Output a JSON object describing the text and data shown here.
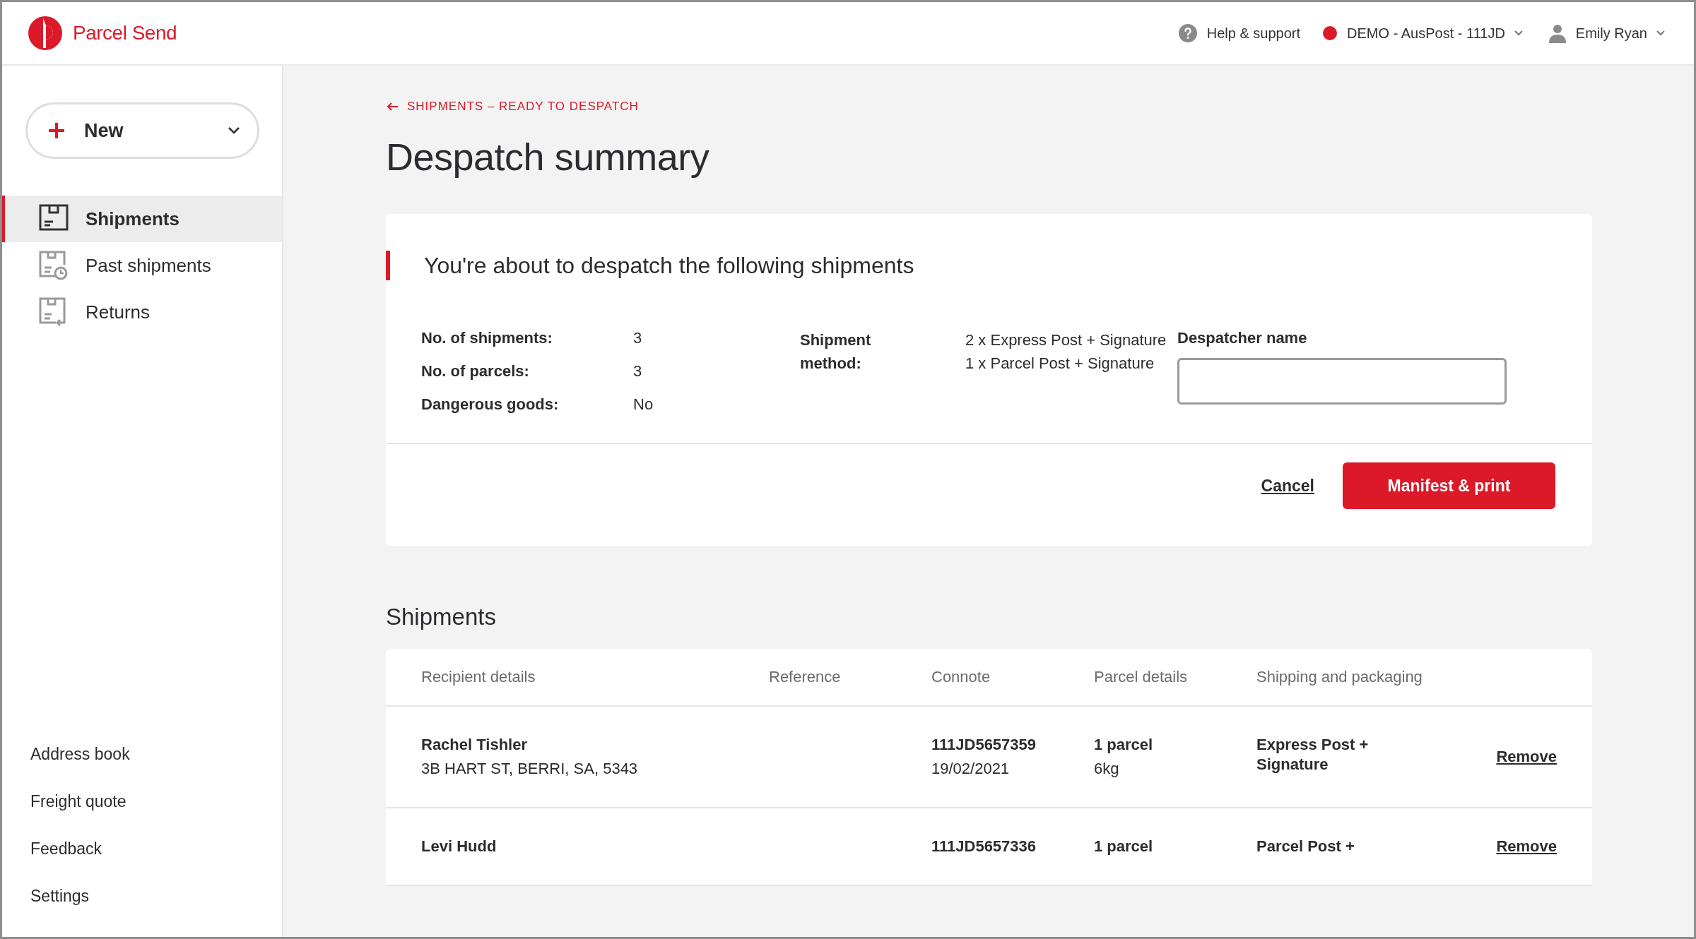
{
  "header": {
    "brand": "Parcel Send",
    "help": "Help & support",
    "account": "DEMO - AusPost - 111JD",
    "user": "Emily Ryan"
  },
  "sidebar": {
    "new_button": "New",
    "nav": [
      {
        "label": "Shipments",
        "selected": true
      },
      {
        "label": "Past shipments",
        "selected": false
      },
      {
        "label": "Returns",
        "selected": false
      }
    ],
    "footer_links": [
      "Address book",
      "Freight quote",
      "Feedback",
      "Settings"
    ]
  },
  "breadcrumb": "SHIPMENTS – READY TO DESPATCH",
  "title": "Despatch summary",
  "summary": {
    "heading": "You're about to despatch the following shipments",
    "facts": [
      {
        "label": "No. of shipments:",
        "value": "3"
      },
      {
        "label": "No. of parcels:",
        "value": "3"
      },
      {
        "label": "Dangerous goods:",
        "value": "No"
      }
    ],
    "method_label": "Shipment method:",
    "method_lines": [
      "2 x Express Post + Signature",
      "1 x Parcel Post + Signature"
    ],
    "despatcher_label": "Despatcher name",
    "cancel": "Cancel",
    "submit": "Manifest & print"
  },
  "shipments": {
    "heading": "Shipments",
    "columns": [
      "Recipient details",
      "Reference",
      "Connote",
      "Parcel details",
      "Shipping and packaging"
    ],
    "rows": [
      {
        "name": "Rachel Tishler",
        "address": "3B HART ST, BERRI, SA, 5343",
        "connote": "111JD5657359",
        "date": "19/02/2021",
        "parcels": "1 parcel",
        "weight": "6kg",
        "shipping": "Express Post + Signature",
        "action": "Remove"
      },
      {
        "name": "Levi Hudd",
        "connote": "111JD5657336",
        "parcels": "1 parcel",
        "shipping": "Parcel Post +",
        "action": "Remove"
      }
    ]
  }
}
